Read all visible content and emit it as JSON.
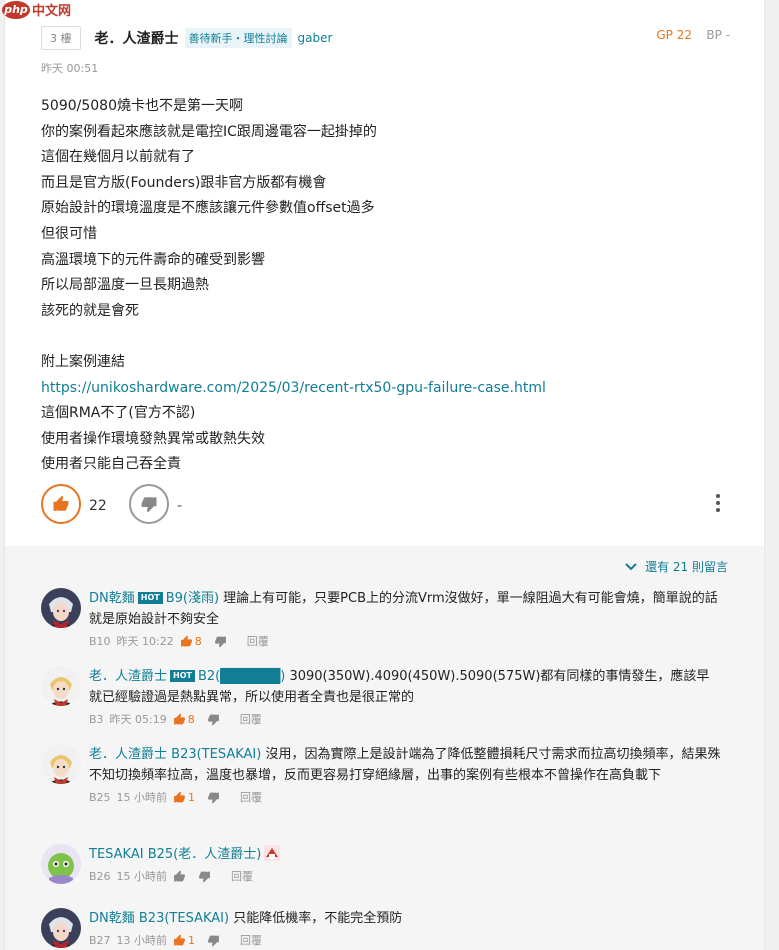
{
  "watermark": {
    "badge": "php",
    "text": "中文网"
  },
  "post": {
    "floor": "3 樓",
    "author": "老．人渣爵士",
    "tag": "善待新手・理性討論",
    "uid": "gaber",
    "gp": "GP 22",
    "bp": "BP -",
    "time": "昨天 00:51",
    "lines": [
      "5090/5080燒卡也不是第一天啊",
      "你的案例看起來應該就是電控IC跟周邊電容一起掛掉的",
      "這個在幾個月以前就有了",
      "而且是官方版(Founders)跟非官方版都有機會",
      "原始設計的環境溫度是不應該讓元件參數值offset過多",
      "但很可惜",
      "高溫環境下的元件壽命的確受到影響",
      "所以局部溫度一旦長期過熱",
      "該死的就是會死"
    ],
    "attach_label": "附上案例連結",
    "link": "https://unikoshardware.com/2025/03/recent-rtx50-gpu-failure-case.html",
    "tail_lines": [
      "這個RMA不了(官方不認)",
      "使用者操作環境發熱異常或散熱失效",
      "使用者只能自己吞全責"
    ],
    "gp_count": "22",
    "bp_count": "-"
  },
  "comments_header": {
    "more_label": "還有 21 則留言"
  },
  "comments": [
    {
      "name": "DN乾麵",
      "hot": "HOT",
      "reply": "B9(淺雨)",
      "text": " 理論上有可能，只要PCB上的分流Vrm沒做好，單一線阻過大有可能會燒，簡單說的話就是原始設計不夠安全",
      "floor": "B10",
      "time": "昨天 10:22",
      "gp": "8",
      "reply_btn": "回覆"
    },
    {
      "name": "老．人渣爵士",
      "hot": "HOT",
      "reply": "B2(",
      "reply_redacted": "██████",
      "reply_end": ")",
      "text": " 3090(350W).4090(450W).5090(575W)都有同樣的事情發生，應該早就已經驗證過是熱點異常，所以使用者全責也是很正常的",
      "floor": "B3",
      "time": "昨天 05:19",
      "gp": "8",
      "reply_btn": "回覆"
    },
    {
      "name": "老．人渣爵士",
      "reply": "B23(TESAKAI)",
      "text": " 沒用，因為實際上是設計端為了降低整體損耗尺寸需求而拉高切換頻率，結果殊不知切換頻率拉高，溫度也暴增，反而更容易打穿絕緣層，出事的案例有些根本不曾操作在高負載下",
      "floor": "B25",
      "time": "15 小時前",
      "gp": "1",
      "reply_btn": "回覆"
    },
    {
      "name": "TESAKAI",
      "reply": "B25(老．人渣爵士)",
      "text": "",
      "floor": "B26",
      "time": "15 小時前",
      "gp": "",
      "reply_btn": "回覆"
    },
    {
      "name": "DN乾麵",
      "reply": "B23(TESAKAI)",
      "text": " 只能降低機率，不能完全預防",
      "floor": "B27",
      "time": "13 小時前",
      "gp": "1",
      "reply_btn": "回覆"
    }
  ],
  "colors": {
    "accent": "#117e96",
    "gp": "#e8741f"
  }
}
